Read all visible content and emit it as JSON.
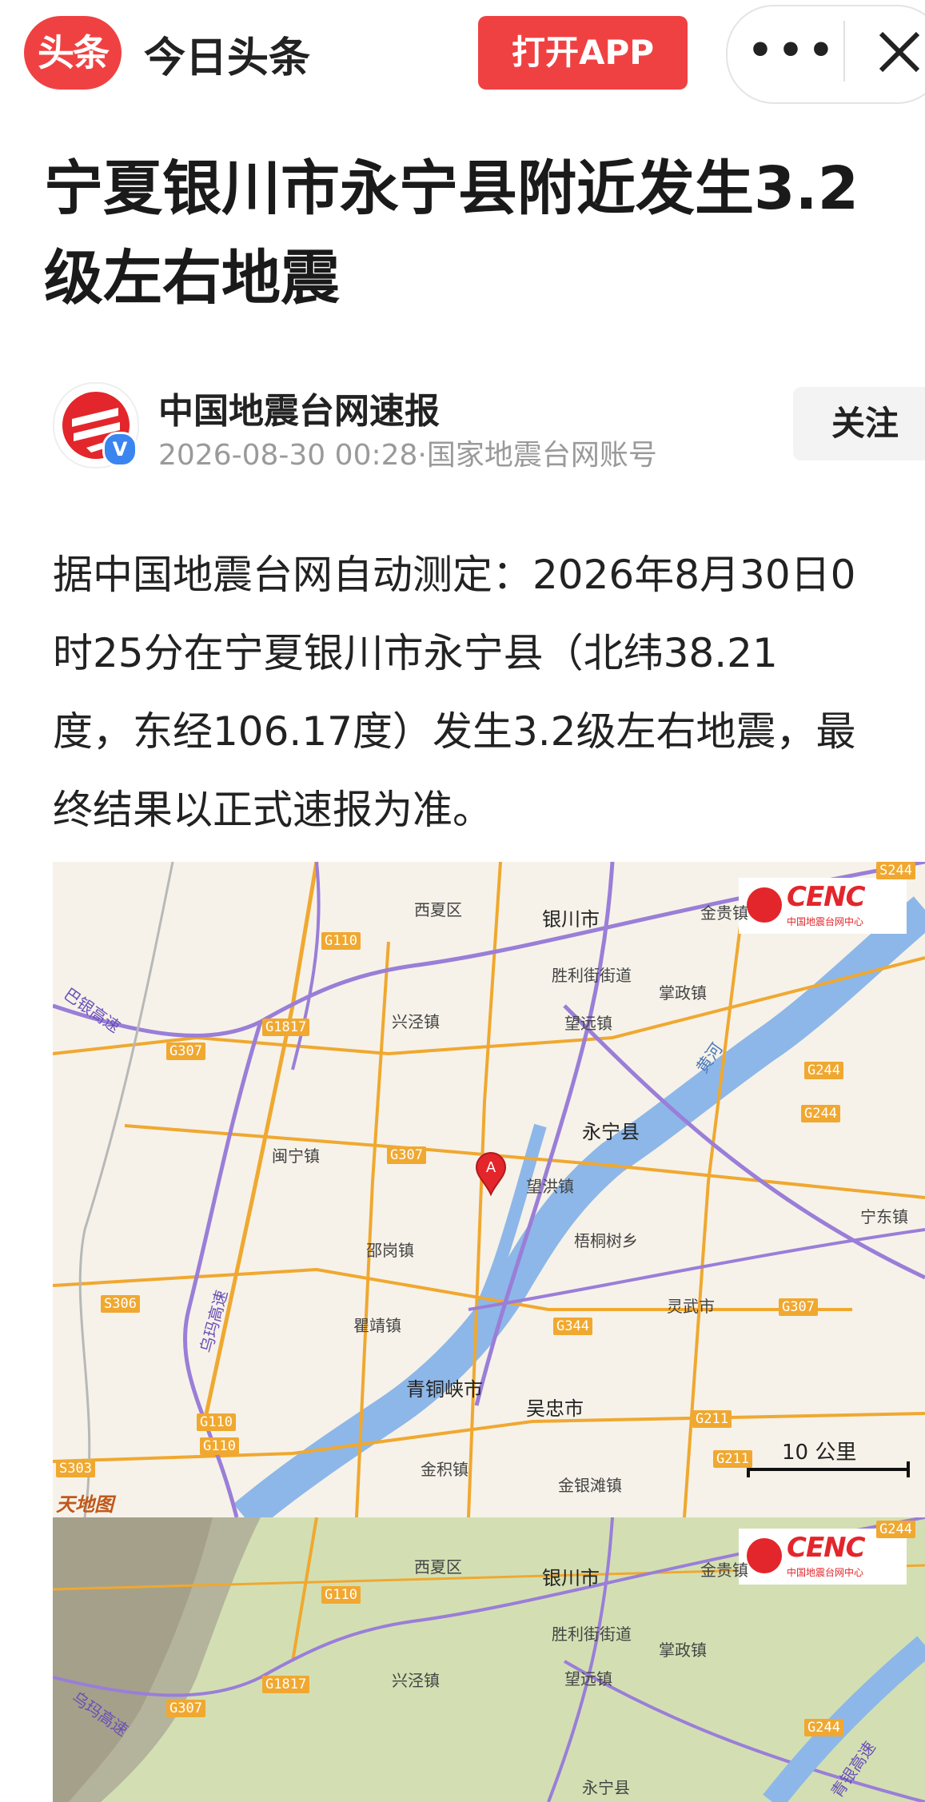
{
  "topbar": {
    "logo_text": "头条",
    "app_name": "今日头条",
    "open_app_label": "打开APP",
    "more_label": "•••",
    "close_icon": "close-icon"
  },
  "article": {
    "title": "宁夏银川市永宁县附近发生3.2级左右地震",
    "author_name": "中国地震台网速报",
    "author_meta": "2026-08-30 00:28·国家地震台网账号",
    "verified_badge": "V",
    "follow_label": "关注",
    "body_lines": [
      "据中国地震台网自动测定：2026年8月30日0",
      "时25分在宁夏银川市永宁县（北纬38.21",
      "度，东经106.17度）发生3.2级左右地震，最",
      "终结果以正式速报为准。"
    ]
  },
  "map": {
    "logo_big": "CENC",
    "logo_small": "中国地震台网中心",
    "scale_label": "10 公里",
    "watermark": "天地图",
    "epicenter_marker": "A",
    "places": {
      "xixia": "西夏区",
      "yinchuan": "银川市",
      "jingui": "金贵镇",
      "shengli": "胜利街街道",
      "zhangzheng": "掌政镇",
      "xingjing": "兴泾镇",
      "wangyuan": "望远镇",
      "yongning": "永宁县",
      "minning": "闽宁镇",
      "wanghong": "望洪镇",
      "shaogang": "邵岗镇",
      "wutong": "梧桐树乡",
      "ningdong": "宁东镇",
      "lingwu": "灵武市",
      "quji": "瞿靖镇",
      "qingtongxia": "青铜峡市",
      "wuzhong": "吴忠市",
      "jinji": "金积镇",
      "jinyintan": "金银滩镇",
      "huanghe": "黄河",
      "wuma": "乌玛高速",
      "bayin": "巴银高速",
      "qingyin": "青银高速"
    },
    "roads": {
      "g110": "G110",
      "g1817": "G1817",
      "g307": "G307",
      "g244": "G244",
      "g344": "G344",
      "g211": "G211",
      "s306": "S306",
      "s303": "S303",
      "s244": "S244"
    }
  },
  "colors": {
    "brand_red": "#f04142",
    "river": "#8db7e8",
    "highway": "#f0a830",
    "expressway": "#9a7ed8",
    "terrain_green": "#d3dfb3"
  }
}
